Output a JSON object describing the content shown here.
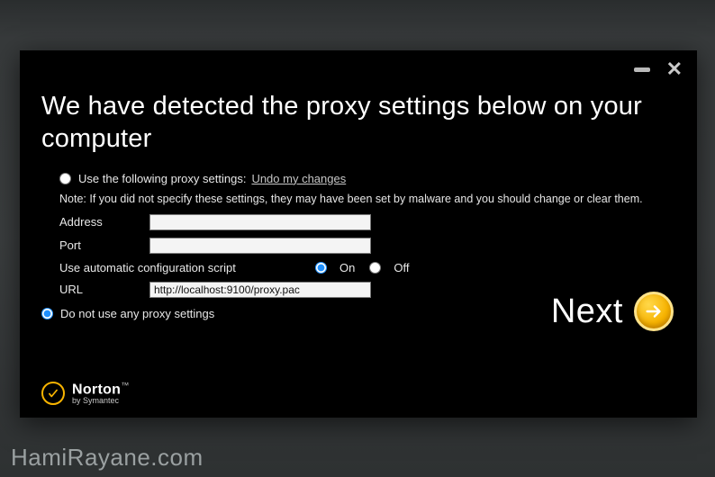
{
  "heading": "We have detected the proxy settings below on your computer",
  "options": {
    "use_following_label": "Use the following proxy settings:",
    "undo_link": "Undo my changes",
    "note": "Note: If you did not specify these settings, they may have been set by malware and you should change or clear them.",
    "address_label": "Address",
    "address_value": "",
    "port_label": "Port",
    "port_value": "",
    "acs_label": "Use automatic configuration script",
    "on_label": "On",
    "off_label": "Off",
    "acs_selected": "on",
    "url_label": "URL",
    "url_value": "http://localhost:9100/proxy.pac",
    "do_not_use_label": "Do not use any proxy settings",
    "top_option_selected": "do_not_use"
  },
  "buttons": {
    "next": "Next"
  },
  "brand": {
    "name": "Norton",
    "byline": "by Symantec"
  },
  "watermark": "HamiRayane.com",
  "colors": {
    "accent": "#f7b300"
  }
}
